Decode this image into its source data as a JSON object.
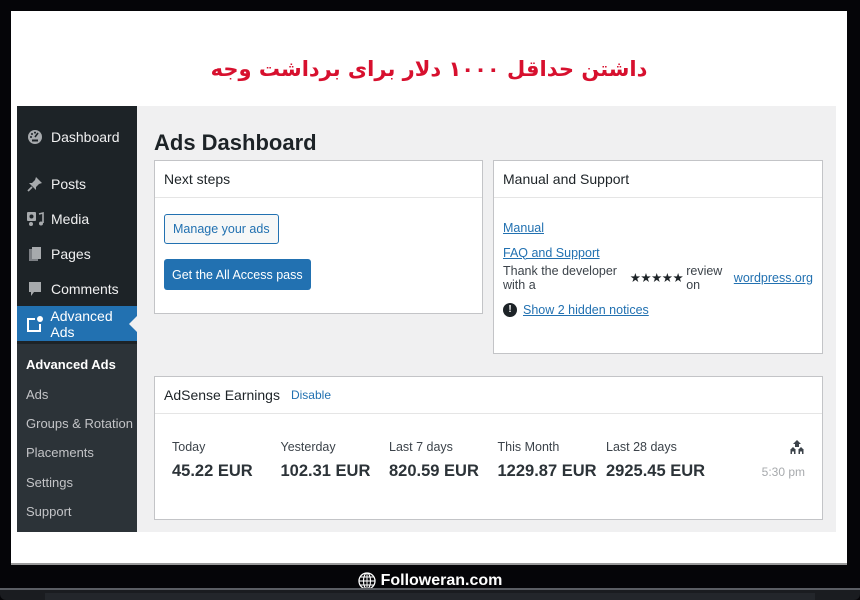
{
  "banner": {
    "headline": "داشتن حداقل ۱۰۰۰ دلار برای برداشت وجه"
  },
  "sidebar": {
    "items": [
      {
        "label": "Dashboard",
        "icon": "dashboard-icon"
      },
      {
        "label": "Posts",
        "icon": "pin-icon"
      },
      {
        "label": "Media",
        "icon": "media-icon"
      },
      {
        "label": "Pages",
        "icon": "pages-icon"
      },
      {
        "label": "Comments",
        "icon": "comment-icon"
      },
      {
        "label": "Advanced Ads",
        "icon": "advanced-ads-icon",
        "active": true
      }
    ],
    "submenu": [
      {
        "label": "Advanced Ads",
        "current": true
      },
      {
        "label": "Ads"
      },
      {
        "label": "Groups & Rotation"
      },
      {
        "label": "Placements"
      },
      {
        "label": "Settings"
      },
      {
        "label": "Support"
      }
    ]
  },
  "main": {
    "title": "Ads Dashboard",
    "next_steps": {
      "title": "Next steps",
      "manage_button": "Manage your ads",
      "access_button": "Get the All Access pass"
    },
    "manual_support": {
      "title": "Manual and Support",
      "manual_link": "Manual",
      "faq_link": "FAQ and Support",
      "thank_prefix": "Thank the developer with a",
      "stars": "★★★★★",
      "thank_suffix": "review on",
      "wordpress_link": "wordpress.org",
      "notice_icon": "!",
      "notices_link": "Show 2 hidden notices"
    },
    "adsense": {
      "title": "AdSense Earnings",
      "disable_link": "Disable",
      "earnings": [
        {
          "label": "Today",
          "value": "45.22 EUR"
        },
        {
          "label": "Yesterday",
          "value": "102.31 EUR"
        },
        {
          "label": "Last 7 days",
          "value": "820.59 EUR"
        },
        {
          "label": "This Month",
          "value": "1229.87 EUR"
        },
        {
          "label": "Last 28 days",
          "value": "2925.45 EUR"
        }
      ],
      "updated_time": "5:30 pm"
    }
  },
  "footer": {
    "brand": "Followeran.com"
  },
  "colors": {
    "accent": "#2271b1",
    "sidebar_bg": "#1d2327",
    "submenu_bg": "#2c3338",
    "headline": "#d7102e",
    "page_bg": "#f0f0f1"
  }
}
